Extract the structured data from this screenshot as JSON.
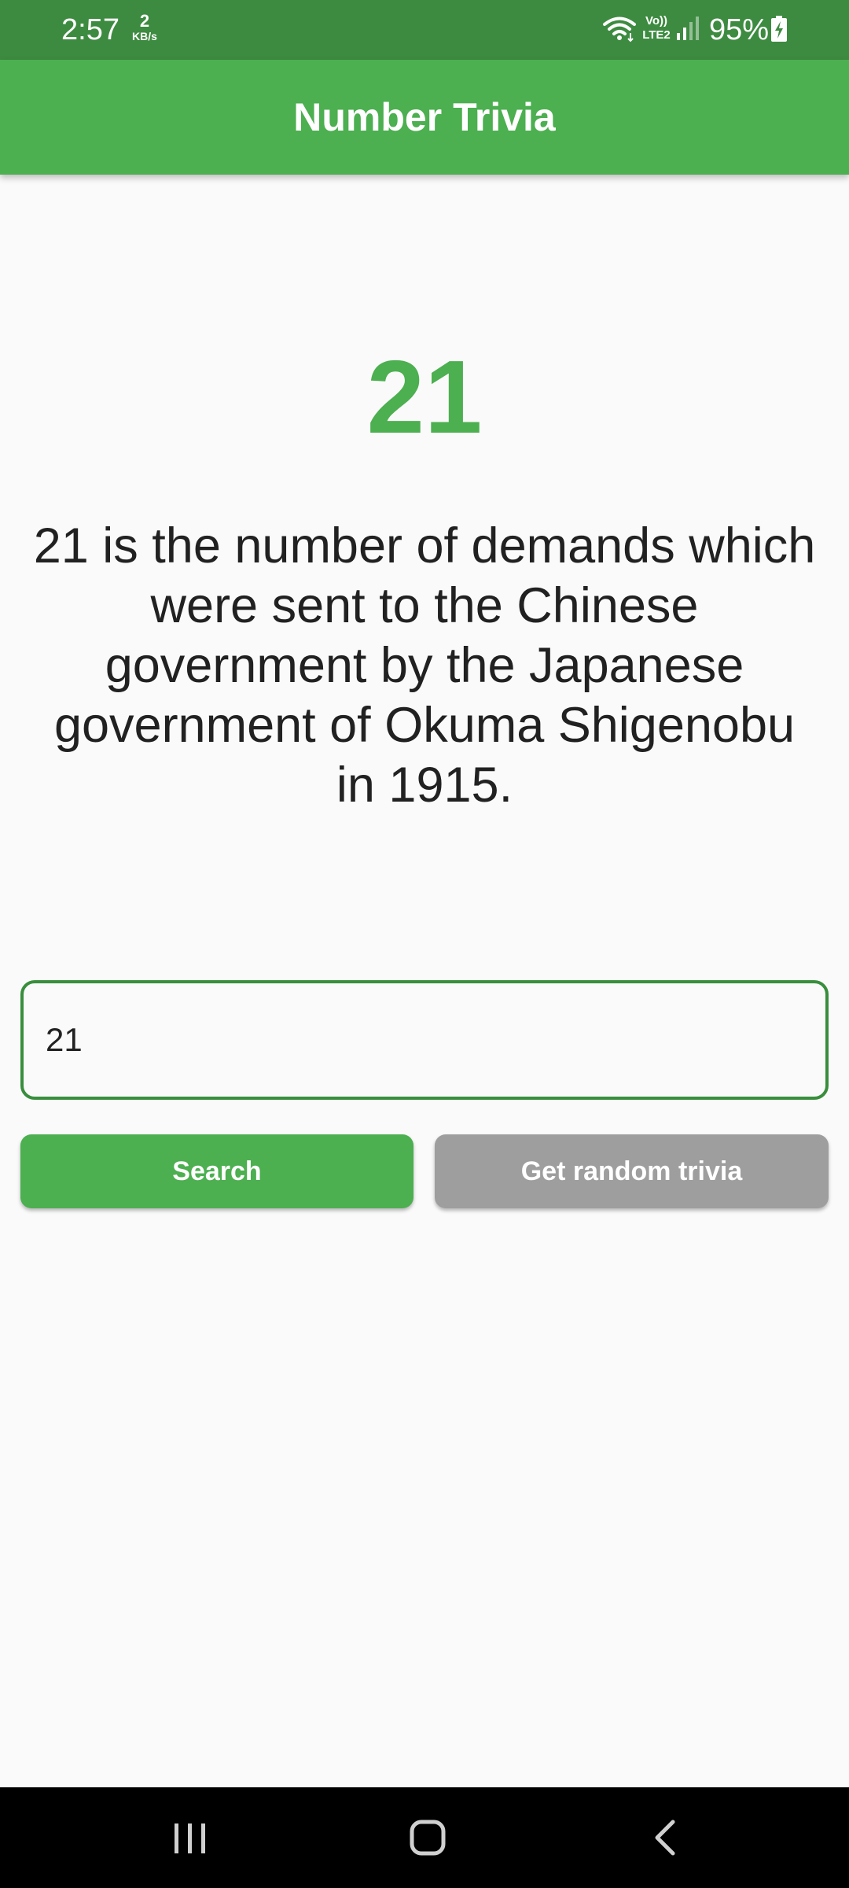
{
  "status_bar": {
    "time": "2:57",
    "net_speed_value": "2",
    "net_speed_unit": "KB/s",
    "network_type": "Vo)) LTE2",
    "battery_percent": "95%",
    "icons": [
      "wifi-icon",
      "signal-icon",
      "battery-charging-icon"
    ]
  },
  "app_bar": {
    "title": "Number Trivia"
  },
  "trivia": {
    "number": "21",
    "text": "21 is the number of demands which were sent to the Chinese government by the Japanese government of Okuma Shigenobu in 1915."
  },
  "search_input": {
    "value": "21",
    "placeholder": ""
  },
  "buttons": {
    "search": "Search",
    "random": "Get random trivia"
  },
  "colors": {
    "status_bar": "#3d8b40",
    "primary": "#4caf50",
    "input_border": "#388e3c",
    "secondary_button": "#9e9e9e",
    "background": "#fafafa",
    "text": "#212121"
  },
  "nav_bar": {
    "icons": [
      "recents-icon",
      "home-icon",
      "back-icon"
    ]
  }
}
